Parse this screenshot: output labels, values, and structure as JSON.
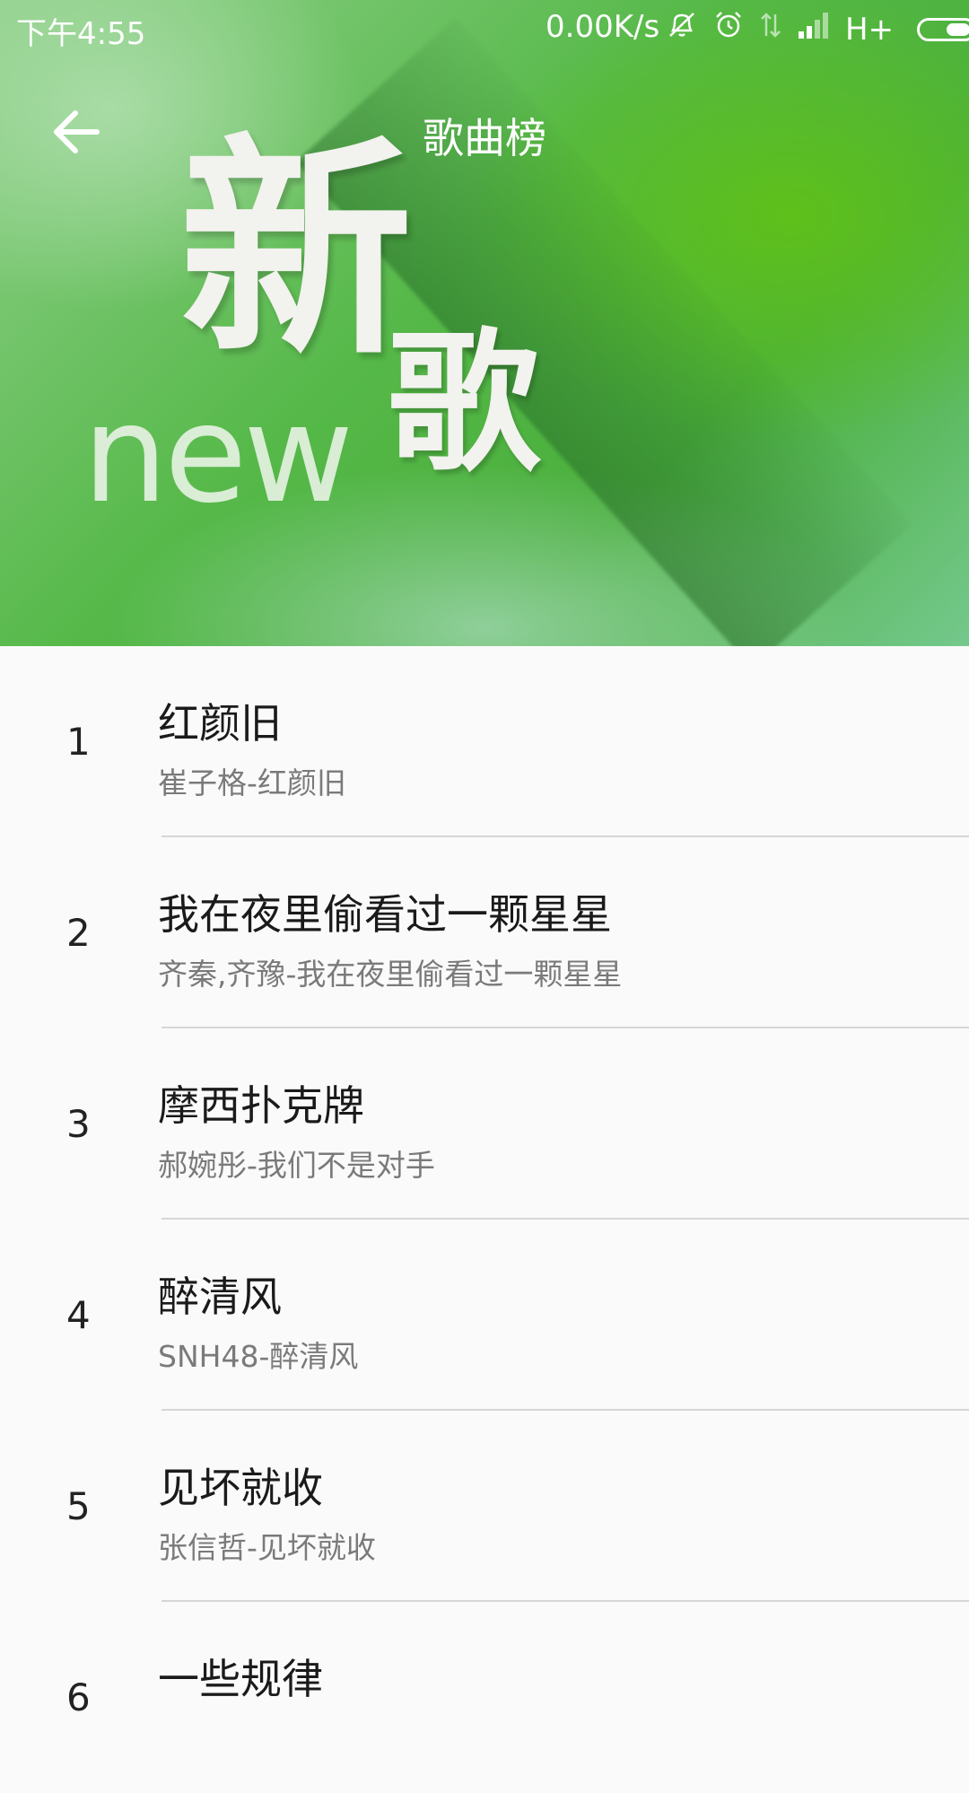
{
  "status_bar": {
    "time": "下午4:55",
    "net_speed": "0.00K/s",
    "network_type": "H+",
    "icons": [
      "mute-icon",
      "alarm-icon",
      "data-arrows-icon",
      "signal-icon",
      "battery-icon"
    ]
  },
  "app_bar": {
    "title": "歌曲榜",
    "back_icon": "arrow-left-icon"
  },
  "banner": {
    "char_1": "新",
    "char_2": "歌",
    "word": "new"
  },
  "songs": [
    {
      "rank": "1",
      "title": "红颜旧",
      "subtitle": "崔子格-红颜旧"
    },
    {
      "rank": "2",
      "title": "我在夜里偷看过一颗星星",
      "subtitle": "齐秦,齐豫-我在夜里偷看过一颗星星"
    },
    {
      "rank": "3",
      "title": "摩西扑克牌",
      "subtitle": "郝婉彤-我们不是对手"
    },
    {
      "rank": "4",
      "title": "醉清风",
      "subtitle": "SNH48-醉清风"
    },
    {
      "rank": "5",
      "title": "见坏就收",
      "subtitle": "张信哲-见坏就收"
    },
    {
      "rank": "6",
      "title": "一些规律",
      "subtitle": ""
    }
  ],
  "colors": {
    "accent_green": "#5ec01a",
    "list_background": "#fafafa",
    "title_text": "#1a1a1a",
    "subtitle_text": "#7a7a7a"
  }
}
